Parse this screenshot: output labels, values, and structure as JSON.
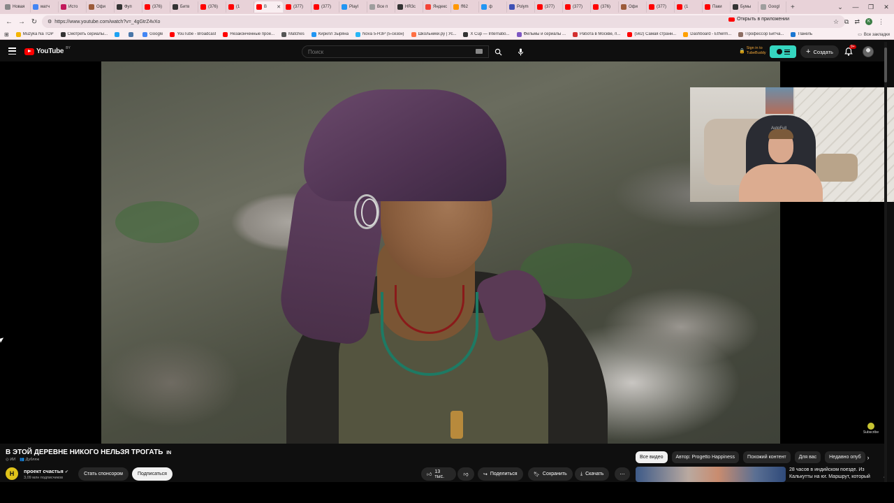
{
  "browser": {
    "tabs": [
      {
        "label": "Новая",
        "color": "#888888"
      },
      {
        "label": "матч",
        "color": "#4285f4"
      },
      {
        "label": "Исто",
        "color": "#c2185b"
      },
      {
        "label": "Офи",
        "color": "#9c5b3a"
      },
      {
        "label": "Фуп",
        "color": "#333333"
      },
      {
        "label": "(376)",
        "color": "#ff0000"
      },
      {
        "label": "Битв",
        "color": "#333333"
      },
      {
        "label": "(376)",
        "color": "#ff0000"
      },
      {
        "label": "(1",
        "color": "#ff0000"
      },
      {
        "label": "В",
        "color": "#ff0000",
        "active": true
      },
      {
        "label": "(377)",
        "color": "#ff0000"
      },
      {
        "label": "(377)",
        "color": "#ff0000"
      },
      {
        "label": "Playl",
        "color": "#2196f3"
      },
      {
        "label": "Все п",
        "color": "#9e9e9e"
      },
      {
        "label": "НR3с",
        "color": "#333333"
      },
      {
        "label": "Яндекс",
        "color": "#f44336"
      },
      {
        "label": "ff62",
        "color": "#ff9800"
      },
      {
        "label": "ф",
        "color": "#2196f3"
      },
      {
        "label": "Polym",
        "color": "#3f51b5"
      },
      {
        "label": "(377)",
        "color": "#ff0000"
      },
      {
        "label": "(377)",
        "color": "#ff0000"
      },
      {
        "label": "(376)",
        "color": "#ff0000"
      },
      {
        "label": "Офи",
        "color": "#9c5b3a"
      },
      {
        "label": "(377)",
        "color": "#ff0000"
      },
      {
        "label": "(1",
        "color": "#ff0000"
      },
      {
        "label": "Паки",
        "color": "#ff0000"
      },
      {
        "label": "Бумы",
        "color": "#333333"
      },
      {
        "label": "Googl",
        "color": "#9e9e9e"
      }
    ],
    "url": "https://www.youtube.com/watch?v=_4gGtrZ4vXo",
    "open_in_app": "Открыть в приложении",
    "bookmarks": [
      {
        "label": "Muzyka Na TOP",
        "color": "#f4b400"
      },
      {
        "label": "Смотреть сериалы...",
        "color": "#333333"
      },
      {
        "label": "",
        "color": "#1da1f2"
      },
      {
        "label": "",
        "color": "#4a76a8"
      },
      {
        "label": "Google",
        "color": "#4285f4"
      },
      {
        "label": "YouTube - Broadcast",
        "color": "#ff0000"
      },
      {
        "label": "Незаконченные прое...",
        "color": "#ff0000"
      },
      {
        "label": "Matches",
        "color": "#555555"
      },
      {
        "label": "Кирилл Зыряна",
        "color": "#2196f3"
      },
      {
        "label": "Nova 5-НЗР (5-сезон)",
        "color": "#29b6f6"
      },
      {
        "label": "Школьники.ру | Ус...",
        "color": "#ff7043"
      },
      {
        "label": "X Cup — Internatio...",
        "color": "#333333"
      },
      {
        "label": "Фильмы и сериалы ...",
        "color": "#7e57c2"
      },
      {
        "label": "Работа в Москве, п...",
        "color": "#d32f2f"
      },
      {
        "label": "(562) Самая странн...",
        "color": "#ff0000"
      },
      {
        "label": "Dashboard - Etherm...",
        "color": "#ffa000"
      },
      {
        "label": "Профессор Битча...",
        "color": "#8d6e63"
      },
      {
        "label": "Панель",
        "color": "#1976d2"
      }
    ],
    "all_bookmarks": "Все закладки"
  },
  "youtube": {
    "logo_text": "YouTube",
    "logo_country": "BY",
    "search_placeholder": "Поиск",
    "tubebuddy_line1": "Sign in to",
    "tubebuddy_line2": "TubeBuddy",
    "create_label": "Создать",
    "notif_count": "9+"
  },
  "player": {
    "watermark_label": "Subscribe",
    "webcam_chair_text": "AutoFull"
  },
  "video": {
    "title": "В ЭТОЙ ДЕРЕВНЕ НИКОГО НЕЛЬЗЯ ТРОГАТЬ",
    "title_badge": "IN",
    "meta_badges": [
      "ИИ",
      "Дубляж"
    ],
    "channel_name": "проект счастья",
    "channel_initial": "H",
    "subscribers": "3,09 млн подписчиков",
    "sponsor_label": "Стать спонсором",
    "subscribe_label": "Подписаться",
    "likes": "13 тыс.",
    "share_label": "Поделиться",
    "save_label": "Сохранить",
    "download_label": "Скачать"
  },
  "sidebar": {
    "chips": [
      {
        "label": "Все видео",
        "selected": true
      },
      {
        "label": "Автор: Progetto Happiness",
        "selected": false
      },
      {
        "label": "Похожий контент",
        "selected": false
      },
      {
        "label": "Для вас",
        "selected": false
      },
      {
        "label": "Недавно опуб",
        "selected": false
      }
    ],
    "recommended_title": "28 часов в индийском поезде. Из Калькутты на юг. Маршрут, который"
  }
}
